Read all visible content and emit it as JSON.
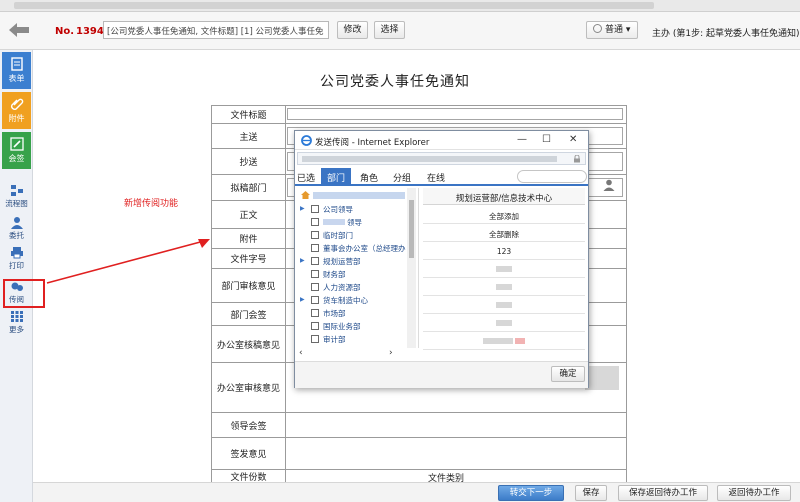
{
  "toolbar": {
    "doc_no_label": "No.",
    "doc_no_value": "1394",
    "title_value": "[公司党委人事任免通知, 文件标题] [1] 公司党委人事任免",
    "edit_label": "修改",
    "select_label": "选择",
    "priority_label": "普通",
    "step_info": "主办 (第1步:  起草党委人事任免通知)"
  },
  "sidebar": {
    "form_label": "表单",
    "attach_label": "附件",
    "sign_label": "会签",
    "flowchart_label": "流程图",
    "delegate_label": "委托",
    "print_label": "打印",
    "circulate_label": "传阅",
    "more_label": "更多"
  },
  "annotation": {
    "text": "新增传阅功能"
  },
  "form": {
    "title": "公司党委人事任免通知",
    "rows": [
      {
        "label": "文件标题"
      },
      {
        "label": "主送"
      },
      {
        "label": "抄送"
      },
      {
        "label": "拟稿部门"
      },
      {
        "label": "正文"
      },
      {
        "label": "附件"
      },
      {
        "label": "文件字号"
      },
      {
        "label": "部门审核意见"
      },
      {
        "label": "部门会签"
      },
      {
        "label": "办公室核稿意见"
      },
      {
        "label": "办公室审核意见"
      },
      {
        "label": "领导会签"
      },
      {
        "label": "签发意见"
      },
      {
        "label": "文件份数"
      }
    ],
    "file_type_label": "文件类别"
  },
  "dialog": {
    "title": "发送传阅 - Internet Explorer",
    "tabs": [
      "已选",
      "部门",
      "角色",
      "分组",
      "在线"
    ],
    "active_tab": 1,
    "tree_items": [
      {
        "name": "公司领导",
        "expandable": true
      },
      {
        "name": "",
        "suffix": "领导",
        "expandable": false,
        "blurred": true
      },
      {
        "name": "临时部门",
        "expandable": false
      },
      {
        "name": "董事会办公室（总经理办",
        "expandable": false
      },
      {
        "name": "规划运营部",
        "expandable": true
      },
      {
        "name": "财务部",
        "expandable": false
      },
      {
        "name": "人力资源部",
        "expandable": false
      },
      {
        "name": "货车制造中心",
        "expandable": true
      },
      {
        "name": "市场部",
        "expandable": false
      },
      {
        "name": "国际业务部",
        "expandable": false
      },
      {
        "name": "审计部",
        "expandable": false
      }
    ],
    "list_header": "规划运营部/信息技术中心",
    "list_rows": [
      "全部添加",
      "全部删除",
      "123"
    ],
    "ok_label": "确定"
  },
  "bottom": {
    "submit_label": "转交下一步",
    "save_label": "保存",
    "save_return_label": "保存返回待办工作",
    "return_label": "返回待办工作"
  },
  "colors": {
    "accent_blue": "#3a74c4",
    "red": "#c00000",
    "tile_blue": "#3b7fd0",
    "tile_orange": "#f0a020",
    "tile_green": "#37a24a"
  }
}
